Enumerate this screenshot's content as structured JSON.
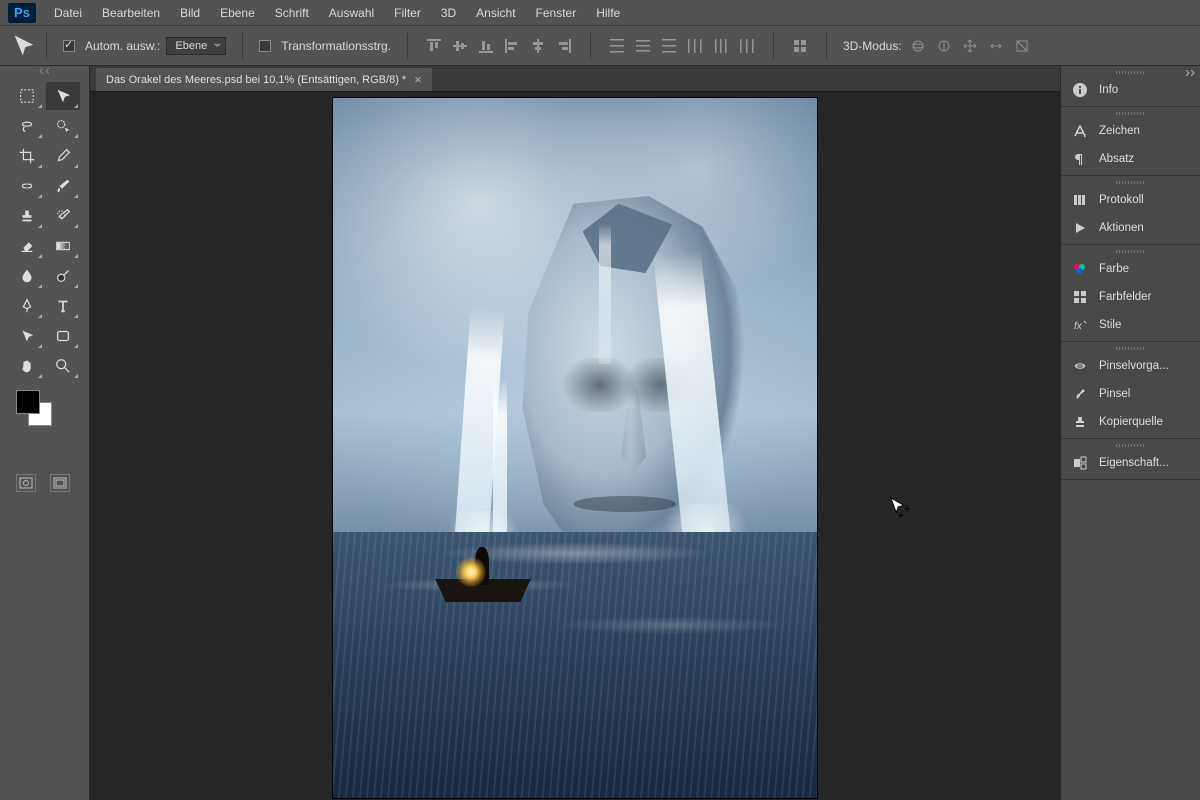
{
  "app": {
    "logo": "Ps"
  },
  "menu": [
    "Datei",
    "Bearbeiten",
    "Bild",
    "Ebene",
    "Schrift",
    "Auswahl",
    "Filter",
    "3D",
    "Ansicht",
    "Fenster",
    "Hilfe"
  ],
  "options": {
    "auto_select_label": "Autom. ausw.:",
    "auto_select_checked": true,
    "target_dropdown": "Ebene",
    "transform_controls_label": "Transformationsstrg.",
    "transform_controls_checked": false,
    "mode3d_label": "3D-Modus:"
  },
  "document": {
    "tab_title": "Das Orakel des Meeres.psd bei 10,1%  (Entsättigen, RGB/8) *"
  },
  "panels": [
    {
      "group": [
        {
          "icon": "info",
          "label": "Info"
        }
      ]
    },
    {
      "group": [
        {
          "icon": "character",
          "label": "Zeichen"
        },
        {
          "icon": "paragraph",
          "label": "Absatz"
        }
      ]
    },
    {
      "group": [
        {
          "icon": "history",
          "label": "Protokoll"
        },
        {
          "icon": "actions",
          "label": "Aktionen"
        }
      ]
    },
    {
      "group": [
        {
          "icon": "color",
          "label": "Farbe"
        },
        {
          "icon": "swatches",
          "label": "Farbfelder"
        },
        {
          "icon": "styles",
          "label": "Stile"
        }
      ]
    },
    {
      "group": [
        {
          "icon": "brushpreset",
          "label": "Pinselvorga..."
        },
        {
          "icon": "brush",
          "label": "Pinsel"
        },
        {
          "icon": "clonesrc",
          "label": "Kopierquelle"
        }
      ]
    },
    {
      "group": [
        {
          "icon": "properties",
          "label": "Eigenschaft..."
        }
      ]
    }
  ],
  "tools": [
    [
      "marquee",
      "move"
    ],
    [
      "lasso",
      "quickselect"
    ],
    [
      "crop",
      "eyedropper"
    ],
    [
      "heal",
      "brush"
    ],
    [
      "stamp",
      "history-brush"
    ],
    [
      "eraser",
      "gradient"
    ],
    [
      "blur",
      "dodge"
    ],
    [
      "pen",
      "type"
    ],
    [
      "path",
      "shape"
    ],
    [
      "hand",
      "zoom"
    ]
  ],
  "colors": {
    "fg": "#000000",
    "bg": "#ffffff"
  }
}
